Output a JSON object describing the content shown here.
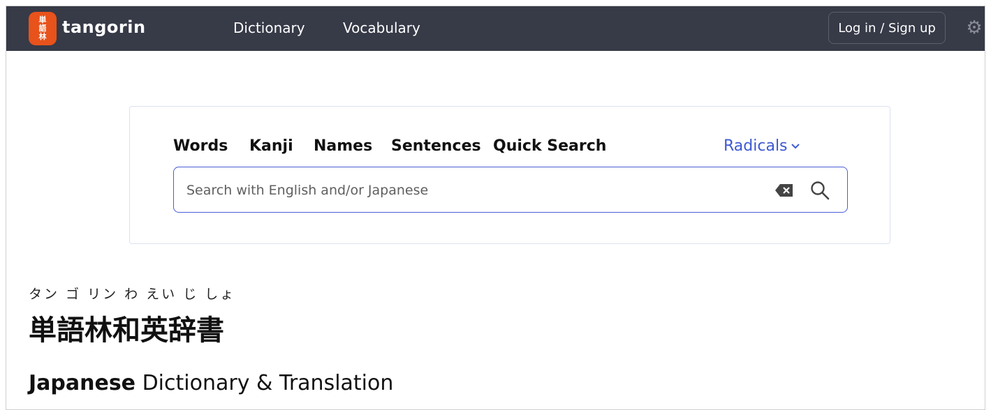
{
  "navbar": {
    "logo_chars": [
      "単",
      "語",
      "林"
    ],
    "brand": "tangorin",
    "links": [
      "Dictionary",
      "Vocabulary"
    ],
    "login_label": "Log in / Sign up",
    "settings_icon": "gear-icon"
  },
  "search": {
    "tabs": [
      "Words",
      "Kanji",
      "Names",
      "Sentences",
      "Quick Search"
    ],
    "radicals_label": "Radicals",
    "radicals_icon": "chevron-down-icon",
    "placeholder": "Search with English and/or Japanese",
    "value": "",
    "clear_icon": "backspace-icon",
    "search_icon": "search-icon"
  },
  "hero": {
    "furigana": "タン ゴ リン わ えい じ しょ",
    "title": "単語林和英辞書",
    "subtitle_bold": "Japanese",
    "subtitle_rest": " Dictionary & Translation"
  },
  "colors": {
    "navbar_bg": "#373a47",
    "logo_bg": "#e8521b",
    "accent": "#3e5ad2"
  }
}
